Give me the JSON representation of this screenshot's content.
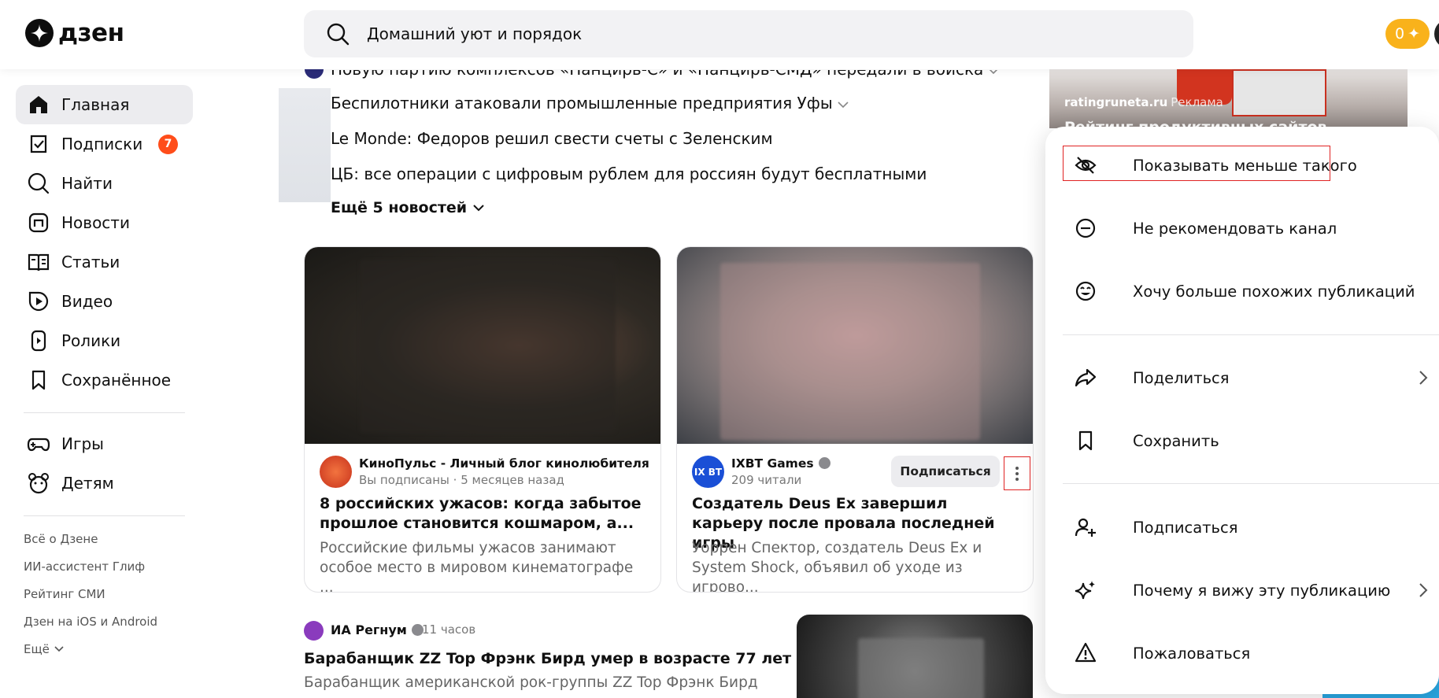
{
  "header": {
    "logo_text": "дзен",
    "search_value": "Домашний уют и порядок",
    "coins_label": "0"
  },
  "sidebar": {
    "items": [
      {
        "label": "Главная",
        "icon": "home-icon",
        "active": true
      },
      {
        "label": "Подписки",
        "icon": "subscriptions-icon",
        "badge": "7"
      },
      {
        "label": "Найти",
        "icon": "search-icon"
      },
      {
        "label": "Новости",
        "icon": "news-icon"
      },
      {
        "label": "Статьи",
        "icon": "articles-icon"
      },
      {
        "label": "Видео",
        "icon": "video-icon"
      },
      {
        "label": "Ролики",
        "icon": "shorts-icon"
      },
      {
        "label": "Сохранённое",
        "icon": "bookmark-icon"
      }
    ],
    "extra_items": [
      {
        "label": "Игры",
        "icon": "gamepad-icon"
      },
      {
        "label": "Детям",
        "icon": "kids-icon"
      }
    ],
    "footer_links": [
      "Всё о Дзене",
      "ИИ-ассистент Глиф",
      "Рейтинг СМИ",
      "Дзен на iOS и Android",
      "Ещё"
    ]
  },
  "news": {
    "items": [
      "Новую партию комплексов «Панцирь-С» и «Панцирь-СМД» передали в войска",
      "Беспилотники атаковали промышленные предприятия Уфы",
      "Le Monde: Федоров решил свести счеты с Зеленским",
      "ЦБ: все операции с цифровым рублем для россиян будут бесплатными"
    ],
    "more_label": "Ещё 5 новостей"
  },
  "cards": [
    {
      "channel": "КиноПульс - Личный блог кинолюбителя",
      "meta": "Вы подписаны · 5 месяцев назад",
      "title": "8 российских ужасов: когда забытое прошлое становится кошмаром, а...",
      "snippet": "Российские фильмы ужасов занимают особое место в мировом кинематографе ..."
    },
    {
      "channel": "IXBT Games",
      "avatar_text": "IX BT",
      "meta": "209 читали",
      "subscribe_label": "Подписаться",
      "title": "Создатель Deus Ex завершил карьеру после провала последней игры",
      "snippet": "Уоррен Спектор, создатель Deus Ex и System Shock, объявил об уходе из игрово..."
    }
  ],
  "small_post": {
    "channel": "ИА Регнум",
    "time": "11 часов",
    "title": "Барабанщик ZZ Top Фрэнк Бирд умер в возрасте 77 лет",
    "snippet": "Барабанщик американской рок-группы ZZ Top Фрэнк Бирд"
  },
  "ad": {
    "source": "ratingruneta.ru",
    "label": "Реклама",
    "title": "Рейтинг продуктивных сайтов"
  },
  "menu": {
    "items": [
      {
        "label": "Показывать меньше такого",
        "icon": "eye-off-icon"
      },
      {
        "label": "Не рекомендовать канал",
        "icon": "minus-circle-icon"
      },
      {
        "label": "Хочу больше похожих публикаций",
        "icon": "smile-icon"
      },
      {
        "label": "Поделиться",
        "icon": "share-icon"
      },
      {
        "label": "Сохранить",
        "icon": "bookmark-icon"
      },
      {
        "label": "Подписаться",
        "icon": "add-user-icon"
      },
      {
        "label": "Почему я вижу эту публикацию",
        "icon": "sparkle-icon"
      },
      {
        "label": "Пожаловаться",
        "icon": "warning-icon"
      }
    ]
  },
  "colors": {
    "badge": "#ff4d1a",
    "coins": "#f9b21b",
    "highlight_border": "#e02222"
  }
}
